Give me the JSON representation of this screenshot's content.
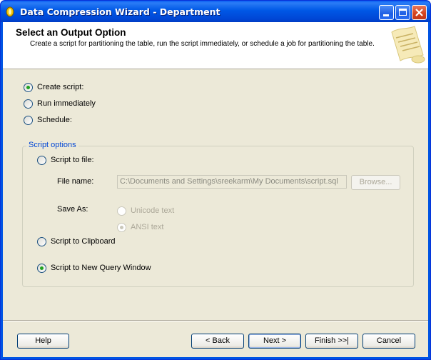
{
  "window": {
    "title": "Data Compression Wizard - Department"
  },
  "header": {
    "title": "Select an Output Option",
    "description": "Create a script for partitioning the table, run the script immediately, or schedule a job for partitioning the table."
  },
  "output_options": [
    {
      "label": "Create script:",
      "checked": true
    },
    {
      "label": "Run immediately",
      "checked": false
    },
    {
      "label": "Schedule:",
      "checked": false
    }
  ],
  "script_options": {
    "legend": "Script options",
    "script_to_file": "Script to file:",
    "file_name_label": "File name:",
    "file_name_value": "C:\\Documents and Settings\\sreekarm\\My Documents\\script.sql",
    "browse_label": "Browse...",
    "save_as_label": "Save As:",
    "unicode_label": "Unicode text",
    "ansi_label": "ANSI text",
    "clipboard_label": "Script to Clipboard",
    "new_query_label": "Script to New Query Window"
  },
  "footer": {
    "help": "Help",
    "back": "< Back",
    "next": "Next >",
    "finish": "Finish >>|",
    "cancel": "Cancel"
  },
  "colors": {
    "titlebar": "#0054e3",
    "dialog_bg": "#ece9d8",
    "legend": "#0046d5",
    "radio_dot": "#21a121"
  }
}
